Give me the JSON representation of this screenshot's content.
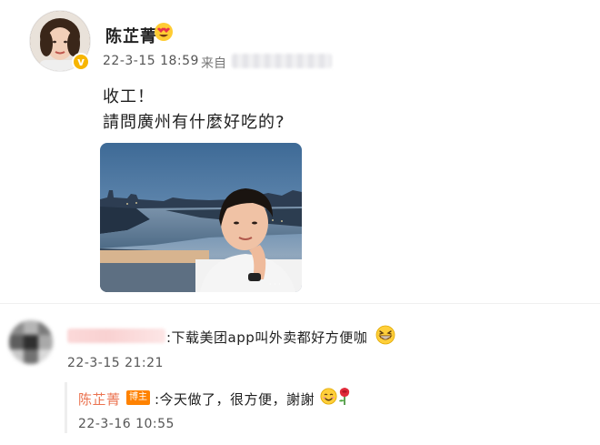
{
  "post": {
    "author": "陈芷菁",
    "author_badge_icon": "heart-eyes-emoji-icon",
    "verified_icon": "verified-badge-icon",
    "verified_mark": "v",
    "time": "22-3-15 18:59",
    "source_label": "来自",
    "lines": [
      "收工！",
      "請問廣州有什麼好吃的?"
    ],
    "photo_icon": "selfie-photo-cityscape"
  },
  "comment": {
    "avatar_icon": "blurred-avatar",
    "text": ":下载美团app叫外卖都好方便咖",
    "emoji_icon": "grinning-face-emoji-icon",
    "time": "22-3-15 21:21",
    "reply": {
      "author": "陈芷菁",
      "badge": "博主",
      "text": ":今天做了，很方便，謝謝",
      "emojis": [
        "smiling-face-emoji-icon",
        "rose-emoji-icon"
      ],
      "time": "22-3-16 10:55"
    }
  },
  "colors": {
    "reply_name": "#eb7350",
    "badge_bg": "#ff8200",
    "verified": "#f7b500"
  }
}
